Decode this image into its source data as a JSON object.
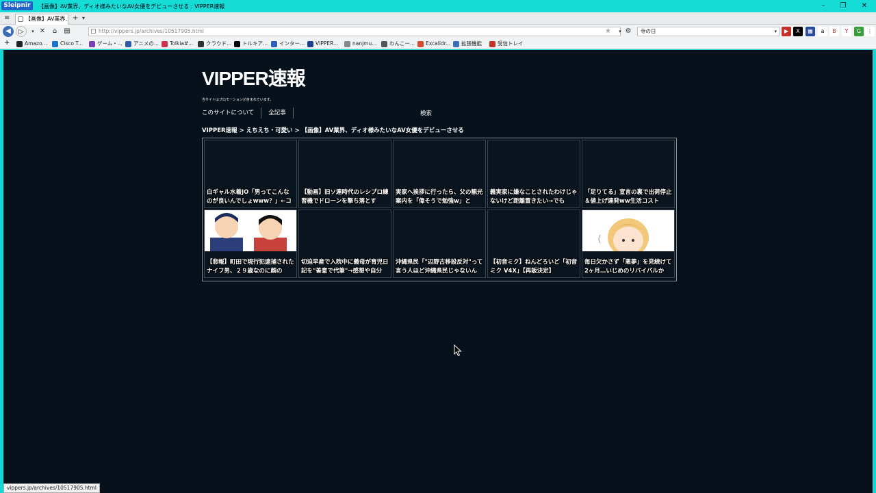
{
  "window": {
    "app_name": "Sleipnir",
    "title": "【画像】AV業界、ディオ様みたいなAV女優をデビューさせる : VIPPER速報"
  },
  "tabs": [
    {
      "label": "【画像】AV業界..."
    }
  ],
  "address": {
    "url": "http://vippers.jp/archives/10517905.html"
  },
  "search": {
    "value": "寺の日"
  },
  "bookmarks": [
    {
      "label": "Amazo...",
      "icon": "amazon-icon",
      "color": "#222222"
    },
    {
      "label": "Cisco T...",
      "icon": "cisco-icon",
      "color": "#1a73c9"
    },
    {
      "label": "ゲーム・...",
      "icon": "game-icon",
      "color": "#7b3fb5"
    },
    {
      "label": "アニメの...",
      "icon": "anime-icon",
      "color": "#2f5aa8"
    },
    {
      "label": "Tolkia#...",
      "icon": "tolkia-icon",
      "color": "#d0304f"
    },
    {
      "label": "クラウド...",
      "icon": "cloud-icon",
      "color": "#333333"
    },
    {
      "label": "トルキア...",
      "icon": "x-icon",
      "color": "#000000"
    },
    {
      "label": "インター...",
      "icon": "inter-icon",
      "color": "#2b62b8"
    },
    {
      "label": "VIPPER...",
      "icon": "vipper-icon",
      "color": "#1d3d8f"
    },
    {
      "label": "nanjmu...",
      "icon": "nanj-icon",
      "color": "#888888"
    },
    {
      "label": "わんこー...",
      "icon": "dog-icon",
      "color": "#555555"
    },
    {
      "label": "Excalidr...",
      "icon": "excalidraw-icon",
      "color": "#d14b2e"
    },
    {
      "label": "拡張機能",
      "icon": "extension-icon",
      "color": "#3b6fb5"
    },
    {
      "label": "受信トレイ",
      "icon": "gmail-icon",
      "color": "#c5332a"
    }
  ],
  "site": {
    "logo": "VIPPER速報",
    "promo": "当サイトはプロモーションが含まれています。",
    "menu": [
      "このサイトについて",
      "全記事"
    ],
    "search_label": "検索",
    "breadcrumb": "VIPPER速報 > えちえち・可愛い > 【画像】AV業界、ディオ様みたいなAV女優をデビューさせる"
  },
  "cards": [
    {
      "caption": "白ギャル水着JO「男ってこんなのが良いんでしょwww？」←コ"
    },
    {
      "caption": "【動画】旧ソ連時代のレシプロ練習機でドローンを撃ち落とす"
    },
    {
      "caption": "実家へ挨拶に行ったら、父の観光案内を「偉そうで勉強w」と"
    },
    {
      "caption": "義実家に嫌なことされたわけじゃないけど距離置きたい→でも"
    },
    {
      "caption": "「足りてる」宣言の裏で出荷停止＆値上げ連発ww生活コスト"
    },
    {
      "caption": "【悲報】町田で現行犯逮捕されたナイフ男、２９歳なのに顔の"
    },
    {
      "caption": "切迫早産で入院中に義母が育児日記を\"善意で代筆\"→感想や自分"
    },
    {
      "caption": "沖縄県民「\"辺野古移設反対\"って言う人ほど沖縄県民じゃないん"
    },
    {
      "caption": "【初音ミク】ねんどろいど「初音ミク V4X」【再販決定】"
    },
    {
      "caption": "毎日欠かさず「悪夢」を見続けて2ヶ月…いじめのリバイバルか"
    }
  ],
  "status": {
    "url": "vippers.jp/archives/10517905.html"
  }
}
